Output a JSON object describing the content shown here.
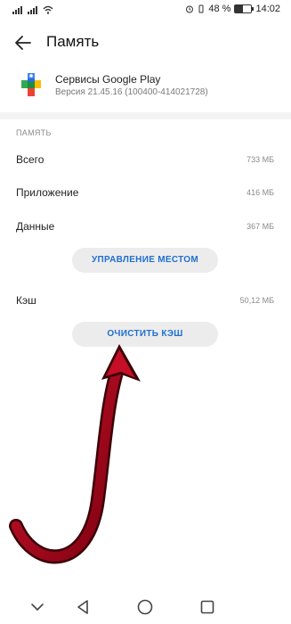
{
  "status_bar": {
    "battery_text": "48 %",
    "time": "14:02"
  },
  "header": {
    "back_icon": "arrow-left-icon",
    "title": "Память"
  },
  "app": {
    "icon": "google-play-services-icon",
    "name": "Сервисы Google Play",
    "version": "Версия 21.45.16 (100400-414021728)"
  },
  "memory": {
    "section_title": "ПАМЯТЬ",
    "rows": [
      {
        "label": "Всего",
        "value": "733 МБ"
      },
      {
        "label": "Приложение",
        "value": "416 МБ"
      },
      {
        "label": "Данные",
        "value": "367 МБ"
      }
    ],
    "manage_button": "УПРАВЛЕНИЕ МЕСТОМ",
    "cache": {
      "label": "Кэш",
      "value": "50,12 МБ"
    },
    "clear_cache_button": "ОЧИСТИТЬ КЭШ"
  },
  "colors": {
    "accent": "#1f6fd1",
    "arrow": "#b3001b",
    "button_bg": "#ececec"
  },
  "nav_bar": {
    "icons": [
      "chevron-down-icon",
      "back-triangle-icon",
      "home-circle-icon",
      "recents-square-icon"
    ]
  }
}
